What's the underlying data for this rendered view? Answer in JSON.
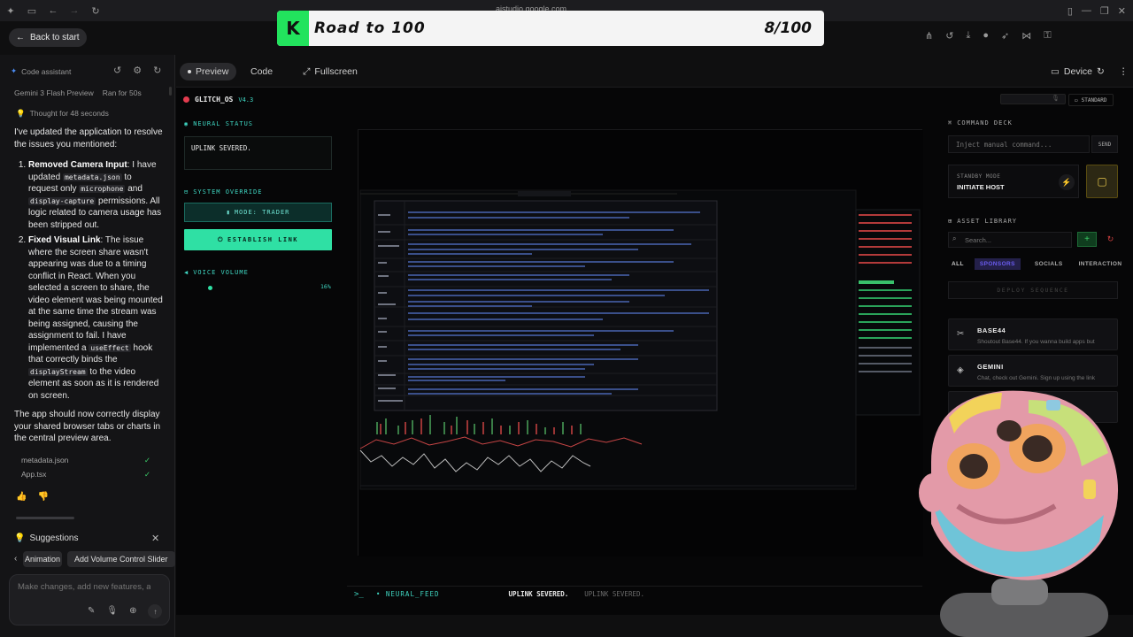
{
  "browser": {
    "url": "aistudio.google.com"
  },
  "banner": {
    "letter": "K",
    "title": "Road to 100",
    "progress_text": "8/100",
    "progress": {
      "current": 8,
      "total": 100
    }
  },
  "header": {
    "back_label": "Back to start"
  },
  "sidebar": {
    "title": "Code assistant",
    "model": "Gemini 3 Flash Preview",
    "run_time": "Ran for 50s",
    "thought": "Thought for 48 seconds",
    "intro": "I've updated the application to resolve the issues you mentioned:",
    "items": [
      {
        "title": "Removed Camera Input",
        "p1": ": I have updated ",
        "code1": "metadata.json",
        "p2": " to request only ",
        "code2": "microphone",
        "p3": " and ",
        "code3": "display-capture",
        "p4": " permissions. All logic related to camera usage has been stripped out."
      },
      {
        "title": "Fixed Visual Link",
        "p1": ": The issue where the screen share wasn't appearing was due to a timing conflict in React. When you selected a screen to share, the video element was being mounted at the same time the stream was being assigned, causing the assignment to fail. I have implemented a ",
        "code1": "useEffect",
        "p2": " hook that correctly binds the ",
        "code2": "displayStream",
        "p3": " to the video element as soon as it is rendered on screen."
      }
    ],
    "outro": "The app should now correctly display your shared browser tabs or charts in the central preview area.",
    "files": [
      "metadata.json",
      "App.tsx"
    ],
    "suggestions_label": "Suggestions",
    "chips": [
      "Animation",
      "Add Volume Control Slider"
    ],
    "prompt_placeholder": "Make changes, add new features, ask for anything"
  },
  "preview": {
    "tabs": [
      "Preview",
      "Code",
      "Fullscreen"
    ],
    "device_label": "Device"
  },
  "glitch": {
    "title": "GLITCH_OS",
    "version": "V4.3",
    "standard_label": "STANDARD",
    "neural_status_label": "NEURAL STATUS",
    "status_text": "UPLINK SEVERED.",
    "system_override_label": "SYSTEM OVERRIDE",
    "mode_label": "MODE: TRADER",
    "establish_label": "ESTABLISH LINK",
    "voice_volume_label": "VOICE VOLUME",
    "volume_percent": "16%",
    "volume_value": 0.16,
    "feed_label": "NEURAL_FEED",
    "feed_items": [
      "UPLINK SEVERED.",
      "UPLINK SEVERED."
    ]
  },
  "command_deck": {
    "label": "COMMAND DECK",
    "input_placeholder": "Inject manual command...",
    "send_label": "SEND",
    "standby_label": "STANDBY MODE",
    "initiate_label": "INITIATE HOST",
    "asset_library_label": "ASSET LIBRARY",
    "search_placeholder": "Search...",
    "filters": [
      "ALL",
      "SPONSORS",
      "SOCIALS",
      "INTERACTION"
    ],
    "deploy_label": "DEPLOY SEQUENCE",
    "assets": [
      {
        "title": "BASE44",
        "desc": "Shoutout Base44. If you wanna build apps but"
      },
      {
        "title": "GEMINI",
        "desc": "Chat, check out Gemini. Sign up using the link"
      }
    ]
  },
  "colors": {
    "accent_green": "#22e35d",
    "teal": "#3fd6c2",
    "establish_bg": "#2fe0a4"
  }
}
